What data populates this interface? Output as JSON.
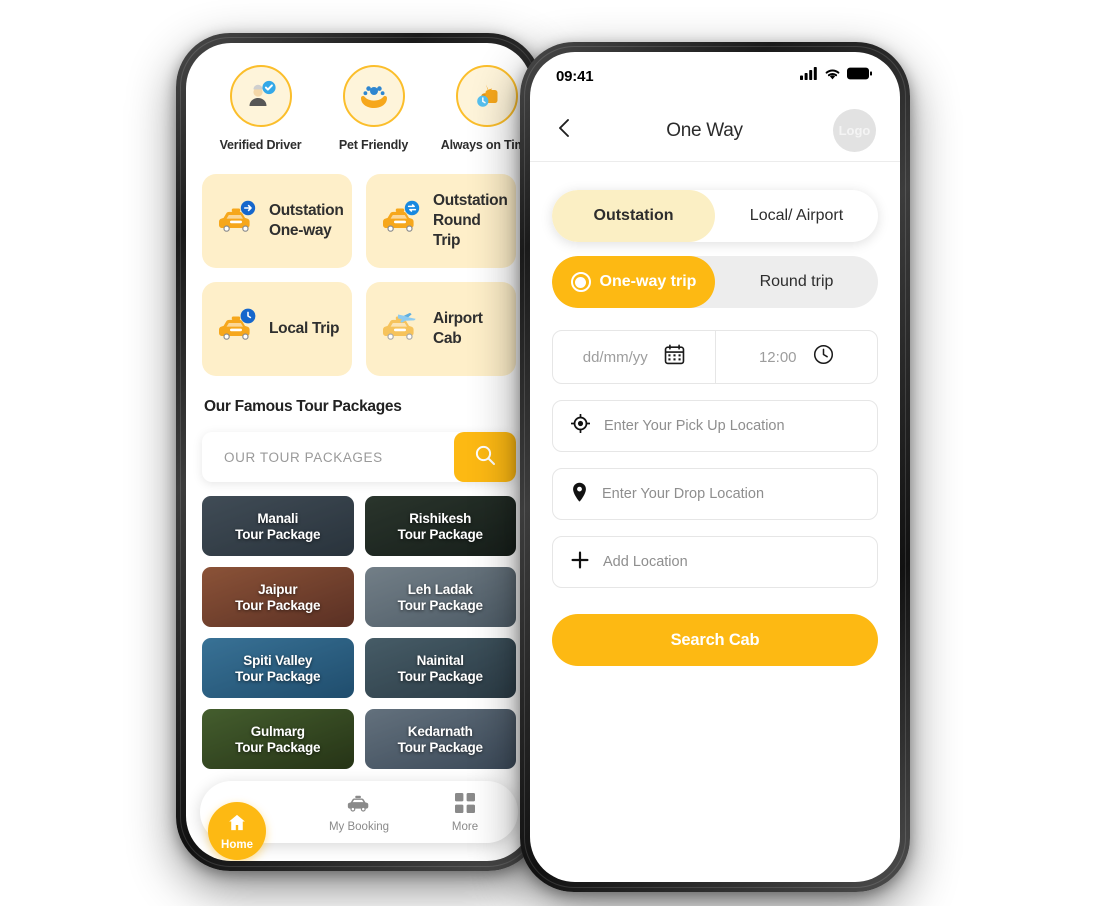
{
  "left_phone": {
    "features": [
      {
        "label": "Verified Driver",
        "icon": "verified-driver-icon"
      },
      {
        "label": "Pet Friendly",
        "icon": "pet-friendly-icon"
      },
      {
        "label": "Always on Time",
        "icon": "always-on-time-icon"
      }
    ],
    "services": [
      {
        "title_line1": "Outstation",
        "title_line2": "One-way",
        "icon": "taxi-arrow-right-icon"
      },
      {
        "title_line1": "Outstation",
        "title_line2": "Round Trip",
        "icon": "taxi-round-trip-icon"
      },
      {
        "title_line1": "Local Trip",
        "title_line2": "",
        "icon": "taxi-clock-icon"
      },
      {
        "title_line1": "Airport Cab",
        "title_line2": "",
        "icon": "taxi-plane-icon"
      }
    ],
    "section_title": "Our Famous Tour Packages",
    "package_search": {
      "placeholder": "OUR TOUR PACKAGES",
      "button_icon": "search-icon"
    },
    "packages": [
      {
        "name": "Manali",
        "sub": "Tour Package",
        "bg": "#4e5b66"
      },
      {
        "name": "Rishikesh",
        "sub": "Tour Package",
        "bg": "#2d3b33"
      },
      {
        "name": "Jaipur",
        "sub": "Tour Package",
        "bg": "#a9654b"
      },
      {
        "name": "Leh Ladak",
        "sub": "Tour Package",
        "bg": "#8a9aa6"
      },
      {
        "name": "Spiti Valley",
        "sub": "Tour Package",
        "bg": "#3a7fae"
      },
      {
        "name": "Nainital",
        "sub": "Tour Package",
        "bg": "#51707f"
      },
      {
        "name": "Gulmarg",
        "sub": "Tour Package",
        "bg": "#4d6b35"
      },
      {
        "name": "Kedarnath",
        "sub": "Tour Package",
        "bg": "#6e8497"
      }
    ],
    "bottom_nav": [
      {
        "label": "Home",
        "icon": "home-icon",
        "active": true
      },
      {
        "label": "My Booking",
        "icon": "taxi-icon",
        "active": false
      },
      {
        "label": "More",
        "icon": "grid-icon",
        "active": false
      }
    ]
  },
  "right_phone": {
    "status_bar": {
      "time": "09:41",
      "icons": [
        "signal-icon",
        "wifi-icon",
        "battery-icon"
      ]
    },
    "nav": {
      "back_icon": "chevron-left-icon",
      "title": "One Way",
      "logo_label": "Logo"
    },
    "trip_type_tabs": [
      {
        "label": "Outstation",
        "active": true
      },
      {
        "label": "Local/ Airport",
        "active": false
      }
    ],
    "direction_tabs": [
      {
        "label": "One-way trip",
        "active": true
      },
      {
        "label": "Round trip",
        "active": false
      }
    ],
    "date_field": {
      "placeholder": "dd/mm/yy",
      "icon": "calendar-icon"
    },
    "time_field": {
      "value": "12:00",
      "icon": "clock-icon"
    },
    "pickup_field": {
      "placeholder": "Enter Your Pick Up Location",
      "icon": "crosshair-location-icon"
    },
    "drop_field": {
      "placeholder": "Enter Your Drop Location",
      "icon": "map-pin-icon"
    },
    "add_location": {
      "label": "Add Location",
      "icon": "plus-icon"
    },
    "search_button": {
      "label": "Search Cab"
    }
  },
  "colors": {
    "accent_yellow": "#FDB913",
    "soft_yellow_card": "#FEEFC9",
    "pale_yellow_tab": "#FBEFC4",
    "icon_circle_bg": "#FEF4DA",
    "icon_circle_border": "#FBBE2B",
    "text_dark": "#2d2d2d",
    "text_muted": "#8e8e8e",
    "segment_track": "#ededed"
  }
}
